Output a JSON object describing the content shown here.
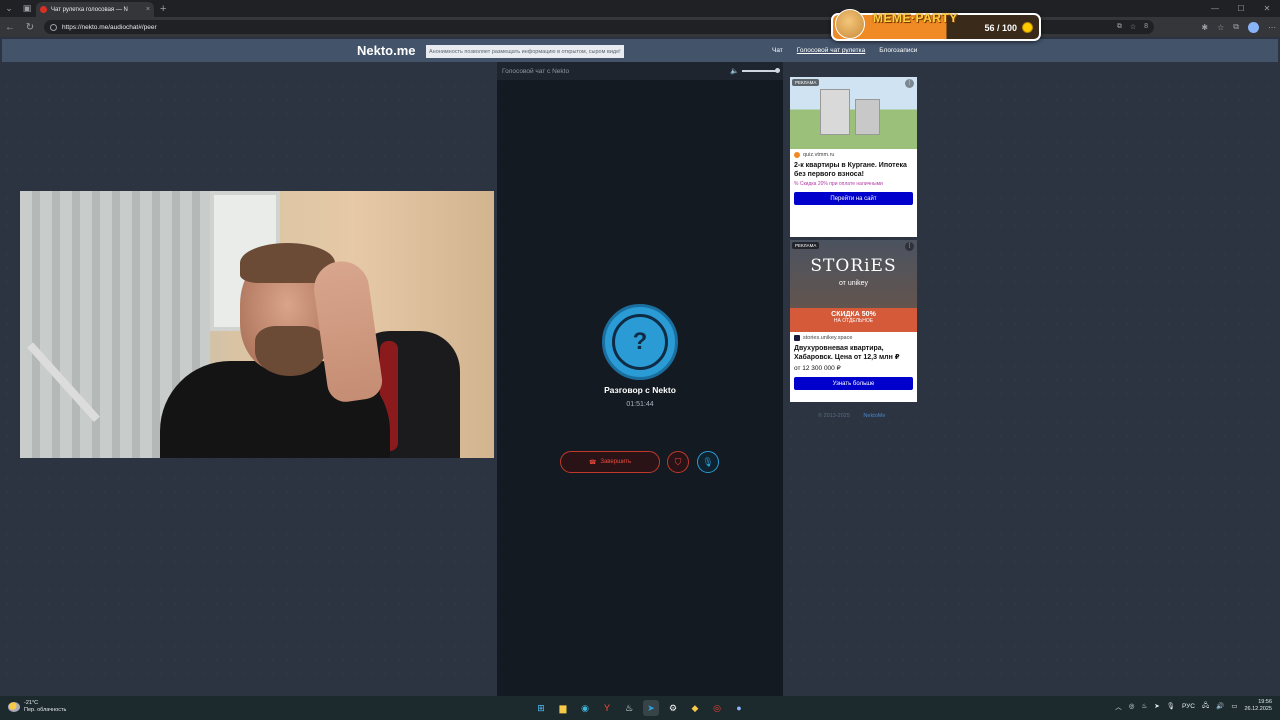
{
  "browser": {
    "tab_title": "Чат рулетка голосовая — N",
    "url": "https://nekto.me/audiochat#/peer",
    "new_tab": "+",
    "tab_close": "×",
    "zoom": "8"
  },
  "extension": {
    "title": "MEME·PARTY",
    "count": "56 / 100"
  },
  "site": {
    "logo": "Nekto.me",
    "notice": "Анонимность позволяет размещать информацию в открытом, сыром виде!",
    "menu": [
      "Чат",
      "Голосовой чат рулетка",
      "Блогозаписи"
    ]
  },
  "chat": {
    "header": "Голосовой чат с Nekto",
    "partner_icon": "?",
    "partner": "Разговор с Nekto",
    "timer": "01:51:44",
    "end_label": "Завершить"
  },
  "ads": [
    {
      "tag": "РЕКЛАМА",
      "source": "quiz.vtmm.ru",
      "headline": "2-к квартиры в Кургане. Ипотека без первого взноса!",
      "promo": "Скидка 20% при оплате наличными",
      "cta": "Перейти на сайт"
    },
    {
      "tag": "РЕКЛАМА",
      "brand": "STORiES",
      "brand_sub": "от unikey",
      "discount": "СКИДКА 50%",
      "discount_sub": "НА ОТДЕЛЬНОЕ",
      "source": "stories.unikey.space",
      "headline": "Двухуровневая квартира, Хабаровск. Цена от 12,3 млн ₽",
      "price": "от 12 300 000 ₽",
      "cta": "Узнать больше"
    }
  ],
  "footer": {
    "copyright": "© 2013-2025",
    "link": "NektoMe"
  },
  "taskbar": {
    "temp": "-21°C",
    "weather": "Пер. облачность",
    "lang": "РУС",
    "time": "19:56",
    "date": "26.12.2025"
  }
}
